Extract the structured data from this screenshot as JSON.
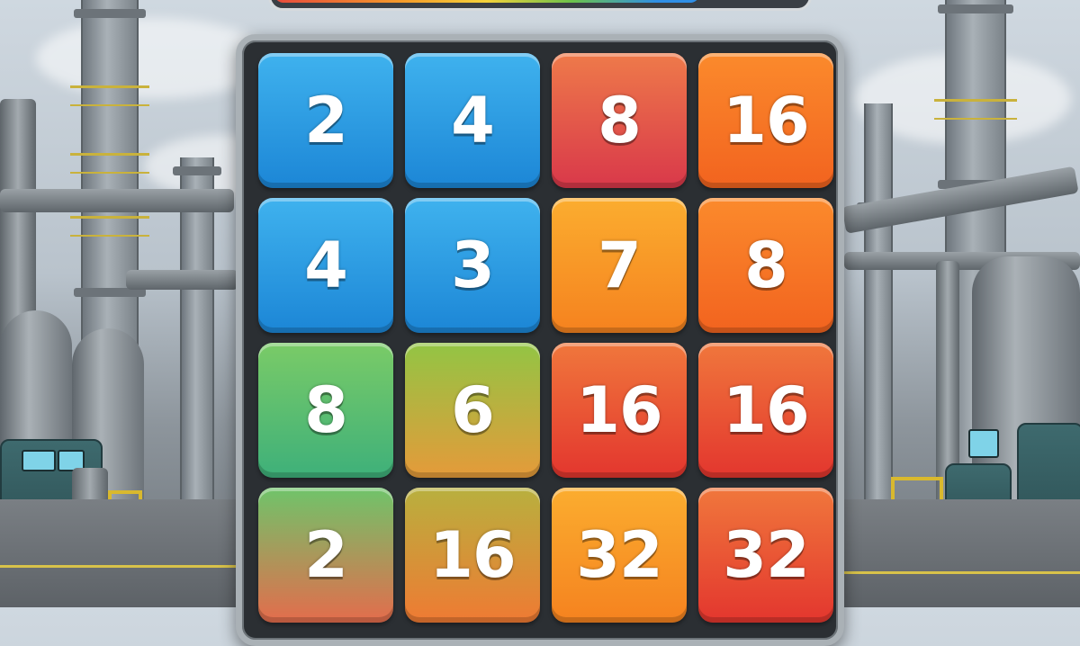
{
  "progress": {
    "fraction": 0.79
  },
  "board": {
    "tiles": [
      {
        "value": "2",
        "color": "blue"
      },
      {
        "value": "4",
        "color": "blue"
      },
      {
        "value": "8",
        "color": "red"
      },
      {
        "value": "16",
        "color": "orange"
      },
      {
        "value": "4",
        "color": "blue"
      },
      {
        "value": "3",
        "color": "blue"
      },
      {
        "value": "7",
        "color": "amber"
      },
      {
        "value": "8",
        "color": "orange"
      },
      {
        "value": "8",
        "color": "green"
      },
      {
        "value": "6",
        "color": "lime"
      },
      {
        "value": "16",
        "color": "redd"
      },
      {
        "value": "16",
        "color": "redd"
      },
      {
        "value": "2",
        "color": "greenred"
      },
      {
        "value": "16",
        "color": "olive"
      },
      {
        "value": "32",
        "color": "amber"
      },
      {
        "value": "32",
        "color": "redd"
      }
    ]
  },
  "colors": {
    "blue": "#2a9be3",
    "red": "#e3564a",
    "orange": "#f5741f",
    "amber": "#f79224",
    "green": "#55ba72",
    "lime": "#c3aa3e",
    "redd": "#e9522f",
    "greenred": "#a89a5a",
    "olive": "#d8943a",
    "board": "#2b2f33",
    "frame": "#aab1b6"
  }
}
